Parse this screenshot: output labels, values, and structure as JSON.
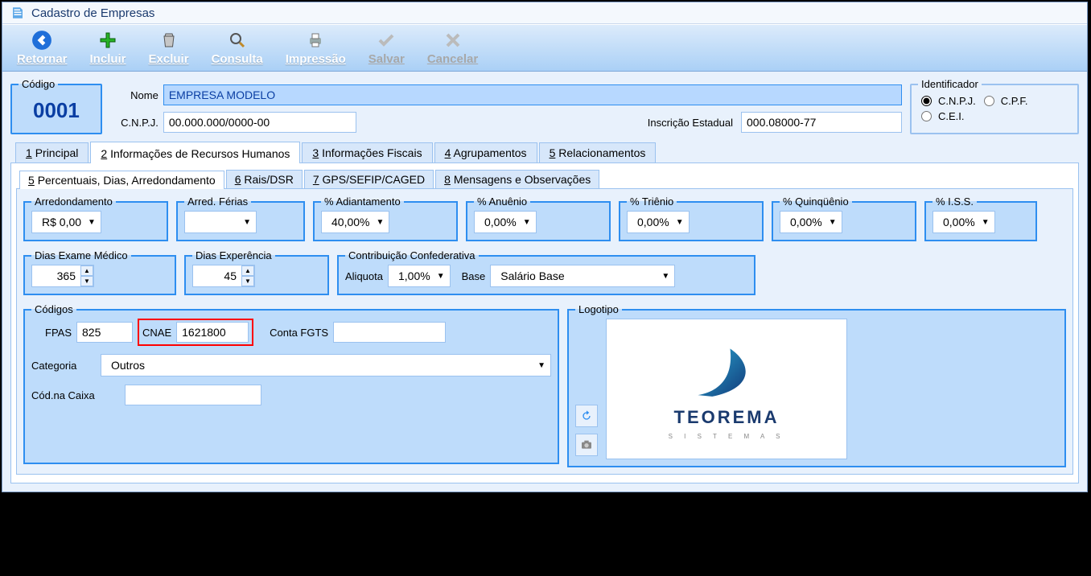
{
  "window": {
    "title": "Cadastro de Empresas"
  },
  "toolbar": {
    "retornar": "Retornar",
    "incluir": "Incluir",
    "excluir": "Excluir",
    "consulta": "Consulta",
    "impressao": "Impressão",
    "salvar": "Salvar",
    "cancelar": "Cancelar"
  },
  "header": {
    "codigo_label": "Código",
    "codigo_value": "0001",
    "nome_label": "Nome",
    "nome_value": "EMPRESA MODELO",
    "cnpj_label": "C.N.P.J.",
    "cnpj_value": "00.000.000/0000-00",
    "ie_label": "Inscrição Estadual",
    "ie_value": "000.08000-77",
    "identificador_label": "Identificador",
    "id_cnpj": "C.N.P.J.",
    "id_cpf": "C.P.F.",
    "id_cei": "C.E.I."
  },
  "tabs": {
    "t1": "Principal",
    "t2": "Informações de Recursos Humanos",
    "t3": "Informações Fiscais",
    "t4": "Agrupamentos",
    "t5": "Relacionamentos"
  },
  "subtabs": {
    "s5": "Percentuais, Dias, Arredondamento",
    "s6": "Rais/DSR",
    "s7": "GPS/SEFIP/CAGED",
    "s8": "Mensagens e Observações"
  },
  "percent": {
    "arredondamento_label": "Arredondamento",
    "arredondamento_val": "R$ 0,00",
    "arred_ferias_label": "Arred. Férias",
    "arred_ferias_val": "",
    "adiantamento_label": "% Adiantamento",
    "adiantamento_val": "40,00%",
    "anuenio_label": "% Anuênio",
    "anuenio_val": "0,00%",
    "trienio_label": "% Triênio",
    "trienio_val": "0,00%",
    "quinquenio_label": "% Quinqüênio",
    "quinquenio_val": "0,00%",
    "iss_label": "% I.S.S.",
    "iss_val": "0,00%"
  },
  "dias": {
    "exame_label": "Dias Exame Médico",
    "exame_val": "365",
    "experiencia_label": "Dias Experência",
    "experiencia_val": "45",
    "confederativa_label": "Contribuição Confederativa",
    "aliquota_label": "Aliquota",
    "aliquota_val": "1,00%",
    "base_label": "Base",
    "base_val": "Salário Base"
  },
  "codigos": {
    "legend": "Códigos",
    "fpas_label": "FPAS",
    "fpas_val": "825",
    "cnae_label": "CNAE",
    "cnae_val": "1621800",
    "conta_fgts_label": "Conta FGTS",
    "conta_fgts_val": "",
    "categoria_label": "Categoria",
    "categoria_val": "Outros",
    "cod_caixa_label": "Cód.na Caixa",
    "cod_caixa_val": ""
  },
  "logotipo": {
    "legend": "Logotipo",
    "brand": "TEOREMA",
    "brand_sub": "S I S T E M A S"
  }
}
